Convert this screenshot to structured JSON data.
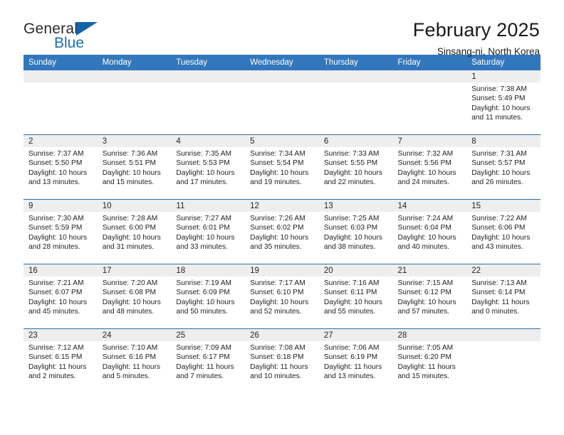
{
  "brand": {
    "name_top": "General",
    "name_bottom": "Blue",
    "triangle_color": "#1463a8",
    "blue_color": "#1c6fb5"
  },
  "header": {
    "month_title": "February 2025",
    "location": "Sinsang-ni, North Korea"
  },
  "theme": {
    "header_row_bg": "#3277bc",
    "header_row_text": "#ffffff",
    "day_band_bg": "#eeeeee",
    "cell_border": "#2e6da4",
    "body_bg": "#ffffff"
  },
  "weekdays": [
    "Sunday",
    "Monday",
    "Tuesday",
    "Wednesday",
    "Thursday",
    "Friday",
    "Saturday"
  ],
  "labels": {
    "sunrise_prefix": "Sunrise:",
    "sunset_prefix": "Sunset:",
    "daylight_prefix": "Daylight:"
  },
  "weeks": [
    [
      {
        "empty": true
      },
      {
        "empty": true
      },
      {
        "empty": true
      },
      {
        "empty": true
      },
      {
        "empty": true
      },
      {
        "empty": true
      },
      {
        "empty": false,
        "day": "1",
        "sunrise": "Sunrise: 7:38 AM",
        "sunset": "Sunset: 5:49 PM",
        "daylight_line1": "Daylight: 10 hours",
        "daylight_line2": "and 11 minutes."
      }
    ],
    [
      {
        "empty": false,
        "day": "2",
        "sunrise": "Sunrise: 7:37 AM",
        "sunset": "Sunset: 5:50 PM",
        "daylight_line1": "Daylight: 10 hours",
        "daylight_line2": "and 13 minutes."
      },
      {
        "empty": false,
        "day": "3",
        "sunrise": "Sunrise: 7:36 AM",
        "sunset": "Sunset: 5:51 PM",
        "daylight_line1": "Daylight: 10 hours",
        "daylight_line2": "and 15 minutes."
      },
      {
        "empty": false,
        "day": "4",
        "sunrise": "Sunrise: 7:35 AM",
        "sunset": "Sunset: 5:53 PM",
        "daylight_line1": "Daylight: 10 hours",
        "daylight_line2": "and 17 minutes."
      },
      {
        "empty": false,
        "day": "5",
        "sunrise": "Sunrise: 7:34 AM",
        "sunset": "Sunset: 5:54 PM",
        "daylight_line1": "Daylight: 10 hours",
        "daylight_line2": "and 19 minutes."
      },
      {
        "empty": false,
        "day": "6",
        "sunrise": "Sunrise: 7:33 AM",
        "sunset": "Sunset: 5:55 PM",
        "daylight_line1": "Daylight: 10 hours",
        "daylight_line2": "and 22 minutes."
      },
      {
        "empty": false,
        "day": "7",
        "sunrise": "Sunrise: 7:32 AM",
        "sunset": "Sunset: 5:56 PM",
        "daylight_line1": "Daylight: 10 hours",
        "daylight_line2": "and 24 minutes."
      },
      {
        "empty": false,
        "day": "8",
        "sunrise": "Sunrise: 7:31 AM",
        "sunset": "Sunset: 5:57 PM",
        "daylight_line1": "Daylight: 10 hours",
        "daylight_line2": "and 26 minutes."
      }
    ],
    [
      {
        "empty": false,
        "day": "9",
        "sunrise": "Sunrise: 7:30 AM",
        "sunset": "Sunset: 5:59 PM",
        "daylight_line1": "Daylight: 10 hours",
        "daylight_line2": "and 28 minutes."
      },
      {
        "empty": false,
        "day": "10",
        "sunrise": "Sunrise: 7:28 AM",
        "sunset": "Sunset: 6:00 PM",
        "daylight_line1": "Daylight: 10 hours",
        "daylight_line2": "and 31 minutes."
      },
      {
        "empty": false,
        "day": "11",
        "sunrise": "Sunrise: 7:27 AM",
        "sunset": "Sunset: 6:01 PM",
        "daylight_line1": "Daylight: 10 hours",
        "daylight_line2": "and 33 minutes."
      },
      {
        "empty": false,
        "day": "12",
        "sunrise": "Sunrise: 7:26 AM",
        "sunset": "Sunset: 6:02 PM",
        "daylight_line1": "Daylight: 10 hours",
        "daylight_line2": "and 35 minutes."
      },
      {
        "empty": false,
        "day": "13",
        "sunrise": "Sunrise: 7:25 AM",
        "sunset": "Sunset: 6:03 PM",
        "daylight_line1": "Daylight: 10 hours",
        "daylight_line2": "and 38 minutes."
      },
      {
        "empty": false,
        "day": "14",
        "sunrise": "Sunrise: 7:24 AM",
        "sunset": "Sunset: 6:04 PM",
        "daylight_line1": "Daylight: 10 hours",
        "daylight_line2": "and 40 minutes."
      },
      {
        "empty": false,
        "day": "15",
        "sunrise": "Sunrise: 7:22 AM",
        "sunset": "Sunset: 6:06 PM",
        "daylight_line1": "Daylight: 10 hours",
        "daylight_line2": "and 43 minutes."
      }
    ],
    [
      {
        "empty": false,
        "day": "16",
        "sunrise": "Sunrise: 7:21 AM",
        "sunset": "Sunset: 6:07 PM",
        "daylight_line1": "Daylight: 10 hours",
        "daylight_line2": "and 45 minutes."
      },
      {
        "empty": false,
        "day": "17",
        "sunrise": "Sunrise: 7:20 AM",
        "sunset": "Sunset: 6:08 PM",
        "daylight_line1": "Daylight: 10 hours",
        "daylight_line2": "and 48 minutes."
      },
      {
        "empty": false,
        "day": "18",
        "sunrise": "Sunrise: 7:19 AM",
        "sunset": "Sunset: 6:09 PM",
        "daylight_line1": "Daylight: 10 hours",
        "daylight_line2": "and 50 minutes."
      },
      {
        "empty": false,
        "day": "19",
        "sunrise": "Sunrise: 7:17 AM",
        "sunset": "Sunset: 6:10 PM",
        "daylight_line1": "Daylight: 10 hours",
        "daylight_line2": "and 52 minutes."
      },
      {
        "empty": false,
        "day": "20",
        "sunrise": "Sunrise: 7:16 AM",
        "sunset": "Sunset: 6:11 PM",
        "daylight_line1": "Daylight: 10 hours",
        "daylight_line2": "and 55 minutes."
      },
      {
        "empty": false,
        "day": "21",
        "sunrise": "Sunrise: 7:15 AM",
        "sunset": "Sunset: 6:12 PM",
        "daylight_line1": "Daylight: 10 hours",
        "daylight_line2": "and 57 minutes."
      },
      {
        "empty": false,
        "day": "22",
        "sunrise": "Sunrise: 7:13 AM",
        "sunset": "Sunset: 6:14 PM",
        "daylight_line1": "Daylight: 11 hours",
        "daylight_line2": "and 0 minutes."
      }
    ],
    [
      {
        "empty": false,
        "day": "23",
        "sunrise": "Sunrise: 7:12 AM",
        "sunset": "Sunset: 6:15 PM",
        "daylight_line1": "Daylight: 11 hours",
        "daylight_line2": "and 2 minutes."
      },
      {
        "empty": false,
        "day": "24",
        "sunrise": "Sunrise: 7:10 AM",
        "sunset": "Sunset: 6:16 PM",
        "daylight_line1": "Daylight: 11 hours",
        "daylight_line2": "and 5 minutes."
      },
      {
        "empty": false,
        "day": "25",
        "sunrise": "Sunrise: 7:09 AM",
        "sunset": "Sunset: 6:17 PM",
        "daylight_line1": "Daylight: 11 hours",
        "daylight_line2": "and 7 minutes."
      },
      {
        "empty": false,
        "day": "26",
        "sunrise": "Sunrise: 7:08 AM",
        "sunset": "Sunset: 6:18 PM",
        "daylight_line1": "Daylight: 11 hours",
        "daylight_line2": "and 10 minutes."
      },
      {
        "empty": false,
        "day": "27",
        "sunrise": "Sunrise: 7:06 AM",
        "sunset": "Sunset: 6:19 PM",
        "daylight_line1": "Daylight: 11 hours",
        "daylight_line2": "and 13 minutes."
      },
      {
        "empty": false,
        "day": "28",
        "sunrise": "Sunrise: 7:05 AM",
        "sunset": "Sunset: 6:20 PM",
        "daylight_line1": "Daylight: 11 hours",
        "daylight_line2": "and 15 minutes."
      },
      {
        "empty": true
      }
    ]
  ]
}
